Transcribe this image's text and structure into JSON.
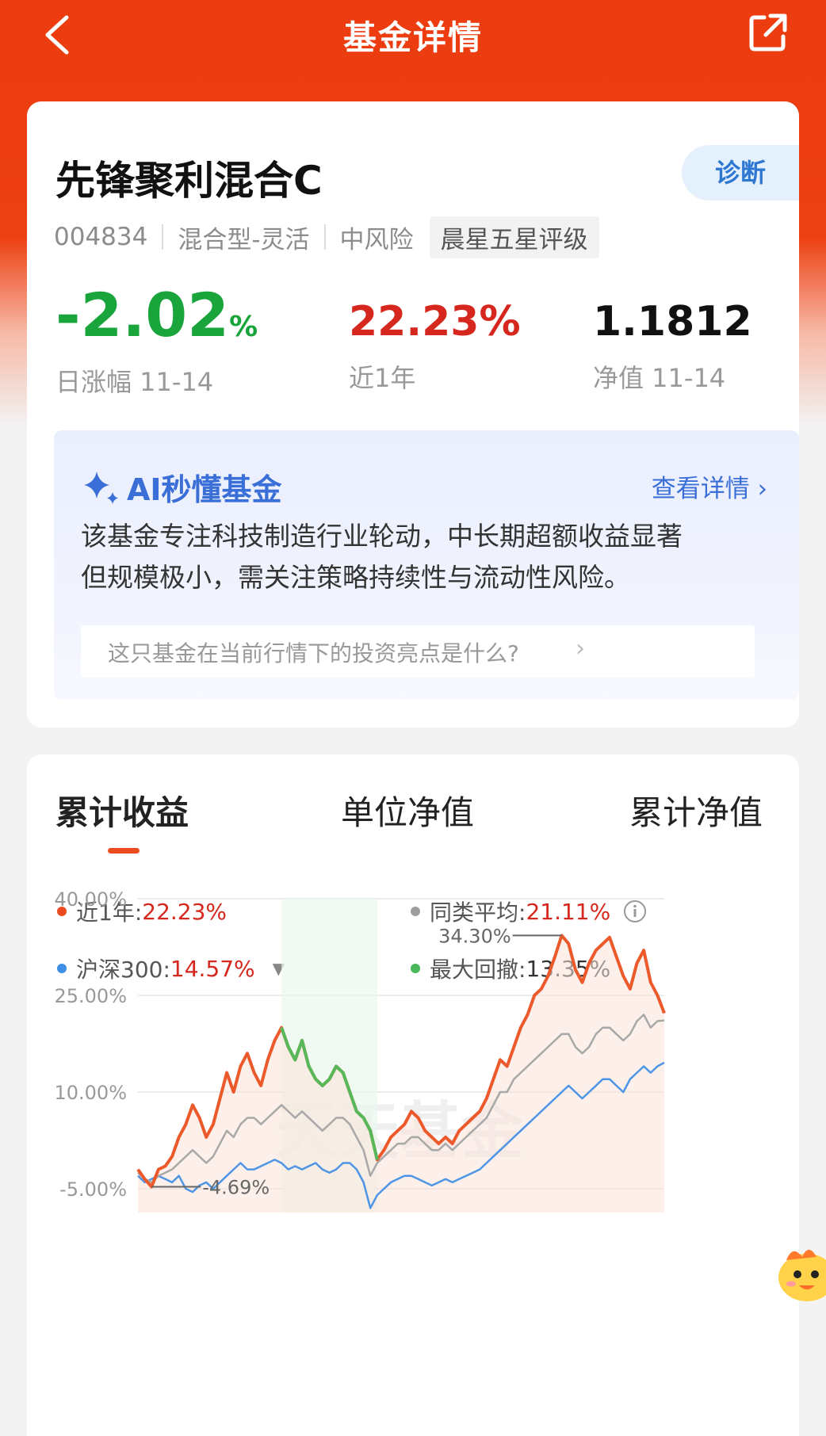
{
  "header": {
    "title": "基金详情",
    "back_icon": "chevron-left-icon",
    "share_icon": "share-icon"
  },
  "fund": {
    "name": "先锋聚利混合C",
    "diagnose_label": "诊断",
    "code": "004834",
    "type": "混合型-灵活",
    "risk": "中风险",
    "rating": "晨星五星评级"
  },
  "stats": {
    "day_change_value": "-2.02",
    "day_change_unit": "%",
    "day_change_label": "日涨幅 11-14",
    "year_return_value": "22.23%",
    "year_return_label": "近1年",
    "nav_value": "1.1812",
    "nav_label": "净值 11-14"
  },
  "ai": {
    "title": "AI秒懂基金",
    "more_label": "查看详情",
    "summary_line1": "该基金专注科技制造行业轮动，中长期超额收益显著",
    "summary_line2": "但规模极小，需关注策略持续性与流动性风险。",
    "question": "这只基金在当前行情下的投资亮点是什么?"
  },
  "tabs": [
    "累计收益",
    "单位净值",
    "累计净值"
  ],
  "legend": {
    "year": {
      "label": "近1年:",
      "value": "22.23%",
      "color": "#ec4b1f"
    },
    "peer": {
      "label": "同类平均:",
      "value": "21.11%",
      "color": "#9e9e9e"
    },
    "hs300": {
      "label": "沪深300:",
      "value": "14.57%",
      "color": "#3d8ee6"
    },
    "drawdown": {
      "label": "最大回撤:",
      "value": "13.35%",
      "color": "#49b85a"
    }
  },
  "colors": {
    "brand": "#ec3c10",
    "fund_line": "#ec5a2c",
    "peer_line": "#a8a8a8",
    "hs300_line": "#4e95e6",
    "drawdown_line": "#57b85a"
  },
  "chart_data": {
    "type": "line",
    "ylim": [
      -5,
      40
    ],
    "y_ticks": [
      "40.00%",
      "25.00%",
      "10.00%",
      "-5.00%"
    ],
    "tick_values": [
      40,
      25,
      10,
      -5
    ],
    "max_label": "34.30%",
    "min_label": "-4.69%",
    "max_value": 34.3,
    "min_value": -4.69,
    "watermark": "天天基金",
    "series": [
      {
        "name": "近1年",
        "values": [
          -2,
          -3.5,
          -4.69,
          -2,
          -1.5,
          0,
          3,
          5,
          8,
          6,
          3,
          5,
          9,
          13,
          10,
          14,
          16,
          13,
          11,
          15,
          18,
          20,
          17,
          15,
          18,
          14,
          12,
          11,
          12,
          14,
          13,
          10,
          7,
          6,
          4,
          -0.5,
          1,
          3,
          4,
          5,
          7,
          6,
          4,
          3,
          2,
          3,
          2,
          4,
          5,
          6,
          7,
          9,
          12,
          15,
          14,
          17,
          20,
          22,
          25,
          26,
          28,
          31,
          34.3,
          33,
          29,
          27,
          30,
          32,
          33,
          34,
          31,
          28,
          26,
          30,
          32,
          27,
          25,
          22.23
        ]
      },
      {
        "name": "同类平均",
        "values": [
          -2.5,
          -3.5,
          -4,
          -3,
          -2.5,
          -2,
          -1,
          0,
          1,
          0,
          -1,
          0,
          2,
          4,
          3,
          5,
          6,
          6,
          5,
          6,
          7,
          8,
          7,
          6,
          7,
          6,
          5,
          4,
          5,
          6,
          6,
          5,
          3,
          1,
          -3,
          -1,
          0,
          1,
          2,
          2,
          3,
          3,
          2,
          1,
          1,
          2,
          1,
          2,
          3,
          4,
          5,
          6,
          8,
          10,
          10,
          12,
          13,
          14,
          15,
          16,
          17,
          18,
          19,
          19,
          17,
          16,
          17,
          19,
          20,
          20,
          19,
          18,
          19,
          21,
          22,
          20,
          21,
          21.11
        ]
      },
      {
        "name": "沪深300",
        "values": [
          -3,
          -4,
          -3.5,
          -3,
          -3.5,
          -4,
          -3,
          -5,
          -5.5,
          -4.5,
          -4,
          -5,
          -4,
          -3,
          -2,
          -1,
          -2,
          -2,
          -1.5,
          -1,
          -0.5,
          -1,
          -2,
          -1.5,
          -2,
          -1.5,
          -1,
          -2,
          -2.5,
          -2,
          -1,
          -1,
          -2,
          -4,
          -8,
          -6,
          -5,
          -4,
          -3.5,
          -3,
          -3,
          -3.5,
          -4,
          -4.5,
          -4,
          -3.5,
          -4,
          -3.5,
          -3,
          -2.5,
          -2,
          -1,
          0,
          1,
          2,
          3,
          4,
          5,
          6,
          7,
          8,
          9,
          10,
          11,
          10,
          9,
          10,
          11,
          12,
          12,
          11,
          10,
          12,
          13,
          14,
          13,
          14,
          14.57
        ]
      }
    ]
  }
}
